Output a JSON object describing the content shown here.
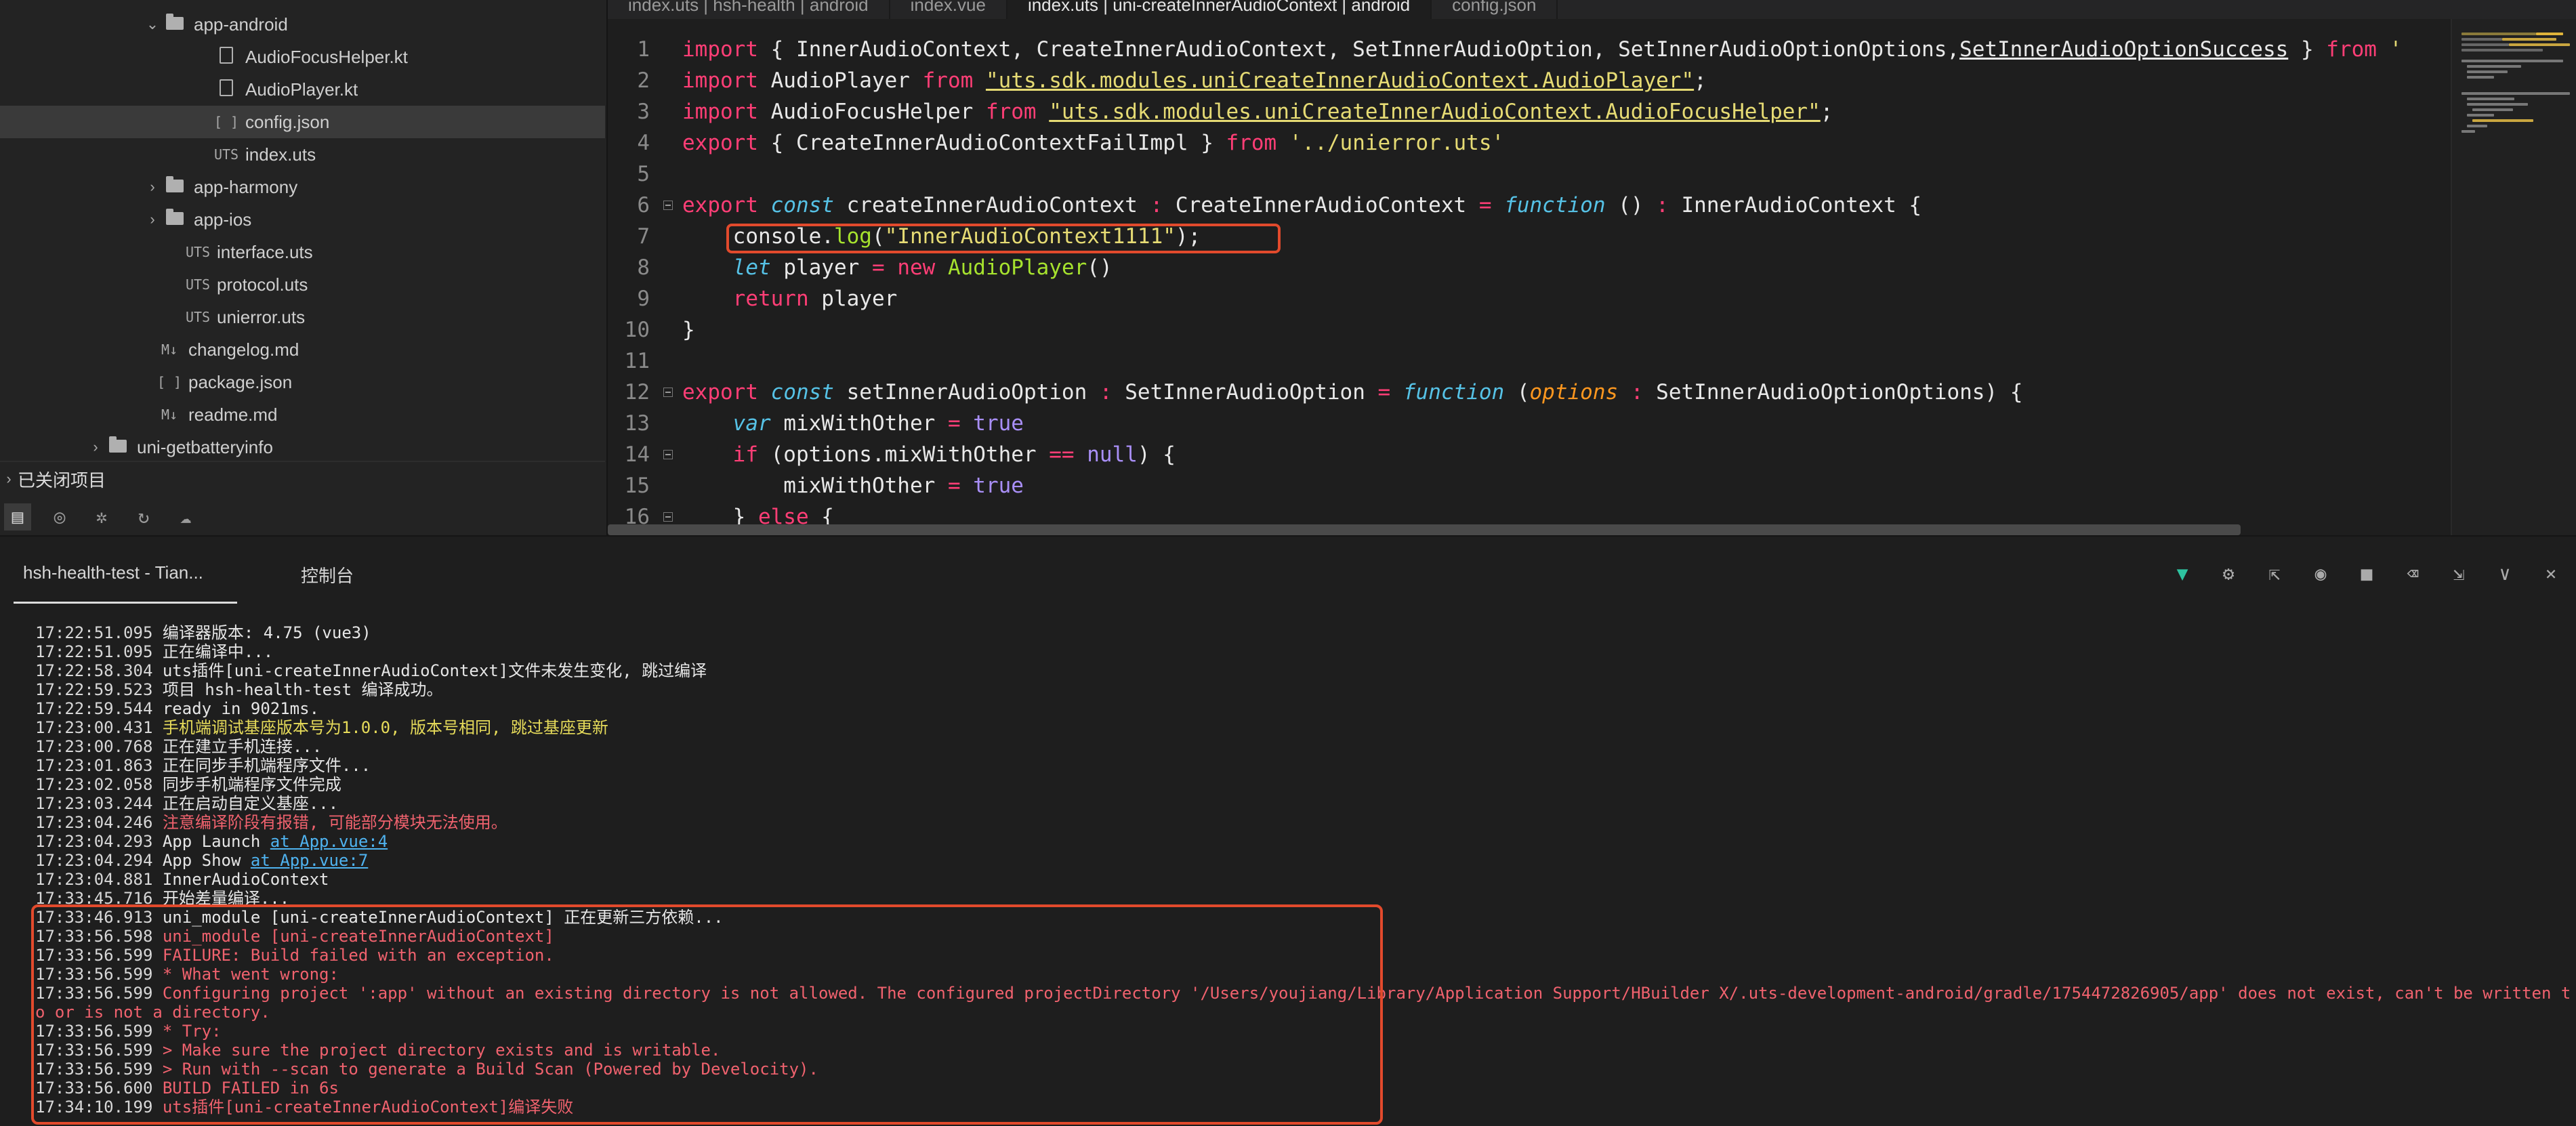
{
  "sidebar": {
    "tree": [
      {
        "label": "app-android",
        "type": "folder",
        "expanded": true,
        "indent": 1
      },
      {
        "label": "AudioFocusHelper.kt",
        "type": "file",
        "icon": "",
        "indent": 2
      },
      {
        "label": "AudioPlayer.kt",
        "type": "file",
        "icon": "",
        "indent": 2
      },
      {
        "label": "config.json",
        "type": "json",
        "icon": "[ ]",
        "indent": 2,
        "selected": true
      },
      {
        "label": "index.uts",
        "type": "uts",
        "icon": "UTS",
        "indent": 2
      },
      {
        "label": "app-harmony",
        "type": "folder",
        "expanded": false,
        "indent": 1
      },
      {
        "label": "app-ios",
        "type": "folder",
        "expanded": false,
        "indent": 1
      },
      {
        "label": "interface.uts",
        "type": "uts",
        "icon": "UTS",
        "indent": 1
      },
      {
        "label": "protocol.uts",
        "type": "uts",
        "icon": "UTS",
        "indent": 1
      },
      {
        "label": "unierror.uts",
        "type": "uts",
        "icon": "UTS",
        "indent": 1
      },
      {
        "label": "changelog.md",
        "type": "md",
        "icon": "M↓",
        "indent": 0
      },
      {
        "label": "package.json",
        "type": "json",
        "icon": "[ ]",
        "indent": 0
      },
      {
        "label": "readme.md",
        "type": "md",
        "icon": "M↓",
        "indent": 0
      },
      {
        "label": "uni-getbatteryinfo",
        "type": "folder",
        "expanded": false,
        "indent": -1
      }
    ],
    "closed_projects_label": "已关闭项目",
    "toolbar_icons": [
      "project-explorer-icon",
      "binoculars-icon",
      "bug-icon",
      "sync-icon",
      "cloud-icon"
    ]
  },
  "editor": {
    "tabs": [
      {
        "label": "index.uts | hsh-health | android",
        "active": false
      },
      {
        "label": "index.vue",
        "active": false
      },
      {
        "label": "index.uts | uni-createInnerAudioContext | android",
        "active": true
      },
      {
        "label": "config.json",
        "active": false
      }
    ],
    "line_numbers": [
      "1",
      "2",
      "3",
      "4",
      "5",
      "6",
      "7",
      "8",
      "9",
      "10",
      "11",
      "12",
      "13",
      "14",
      "15",
      "16"
    ]
  },
  "panel": {
    "tab_project": "hsh-health-test - Tian...",
    "tab_console": "控制台",
    "tool_icons": [
      "run-icon",
      "debug-icon",
      "export-icon",
      "record-icon",
      "stop-icon",
      "clear-icon",
      "open-icon",
      "collapse-icon",
      "close-icon"
    ],
    "logs": [
      {
        "time": "17:22:51.095",
        "text": "编译器版本: 4.75 (vue3)",
        "color": "normal"
      },
      {
        "time": "17:22:51.095",
        "text": "正在编译中...",
        "color": "normal"
      },
      {
        "time": "17:22:58.304",
        "text": "uts插件[uni-createInnerAudioContext]文件未发生变化, 跳过编译",
        "color": "normal"
      },
      {
        "time": "17:22:59.523",
        "text": "项目 hsh-health-test 编译成功。",
        "color": "normal"
      },
      {
        "time": "17:22:59.544",
        "text": "ready in 9021ms.",
        "color": "normal"
      },
      {
        "time": "17:23:00.431",
        "text": "手机端调试基座版本号为1.0.0, 版本号相同, 跳过基座更新",
        "color": "yellow"
      },
      {
        "time": "17:23:00.768",
        "text": "正在建立手机连接...",
        "color": "normal"
      },
      {
        "time": "17:23:01.863",
        "text": "正在同步手机端程序文件...",
        "color": "normal"
      },
      {
        "time": "17:23:02.058",
        "text": "同步手机端程序文件完成",
        "color": "normal"
      },
      {
        "time": "17:23:03.244",
        "text": "正在启动自定义基座...",
        "color": "normal"
      },
      {
        "time": "17:23:04.246",
        "text": "注意编译阶段有报错, 可能部分模块无法使用。",
        "color": "red"
      },
      {
        "time": "17:23:04.293",
        "text": "App Launch ",
        "link": "at App.vue:4",
        "color": "normal"
      },
      {
        "time": "17:23:04.294",
        "text": "App Show ",
        "link": "at App.vue:7",
        "color": "normal"
      },
      {
        "time": "17:23:04.881",
        "text": "InnerAudioContext",
        "color": "normal"
      },
      {
        "time": "17:33:45.716",
        "text": "开始差量编译...",
        "color": "normal"
      },
      {
        "time": "17:33:46.913",
        "text": "uni_module [uni-createInnerAudioContext] 正在更新三方依赖...",
        "color": "normal"
      },
      {
        "time": "17:33:56.598",
        "text": "uni_module [uni-createInnerAudioContext]",
        "color": "red"
      },
      {
        "time": "17:33:56.599",
        "text": "FAILURE: Build failed with an exception.",
        "color": "red"
      },
      {
        "time": "17:33:56.599",
        "text": "* What went wrong:",
        "color": "red"
      },
      {
        "time": "17:33:56.599",
        "text": "Configuring project ':app' without an existing directory is not allowed. The configured projectDirectory '/Users/youjiang/Library/Application Support/HBuilder X/.uts-development-android/gradle/1754472826905/app' does not exist, can't be written t",
        "color": "red"
      },
      {
        "time": "",
        "text": "o or is not a directory.",
        "color": "red"
      },
      {
        "time": "17:33:56.599",
        "text": "* Try:",
        "color": "red"
      },
      {
        "time": "17:33:56.599",
        "text": "> Make sure the project directory exists and is writable.",
        "color": "red"
      },
      {
        "time": "17:33:56.599",
        "text": "> Run with --scan to generate a Build Scan (Powered by Develocity).",
        "color": "red"
      },
      {
        "time": "17:33:56.600",
        "text": "BUILD FAILED in 6s",
        "color": "red"
      },
      {
        "time": "17:34:10.199",
        "text": "uts插件[uni-createInnerAudioContext]编译失败",
        "color": "red"
      }
    ]
  },
  "colors": {
    "keyword": "#ff3e76",
    "string": "#e6db74",
    "error": "#f0626e",
    "warn": "#e6db5a",
    "highlight_box": "#e24a2c",
    "link": "#4fb3f0"
  }
}
